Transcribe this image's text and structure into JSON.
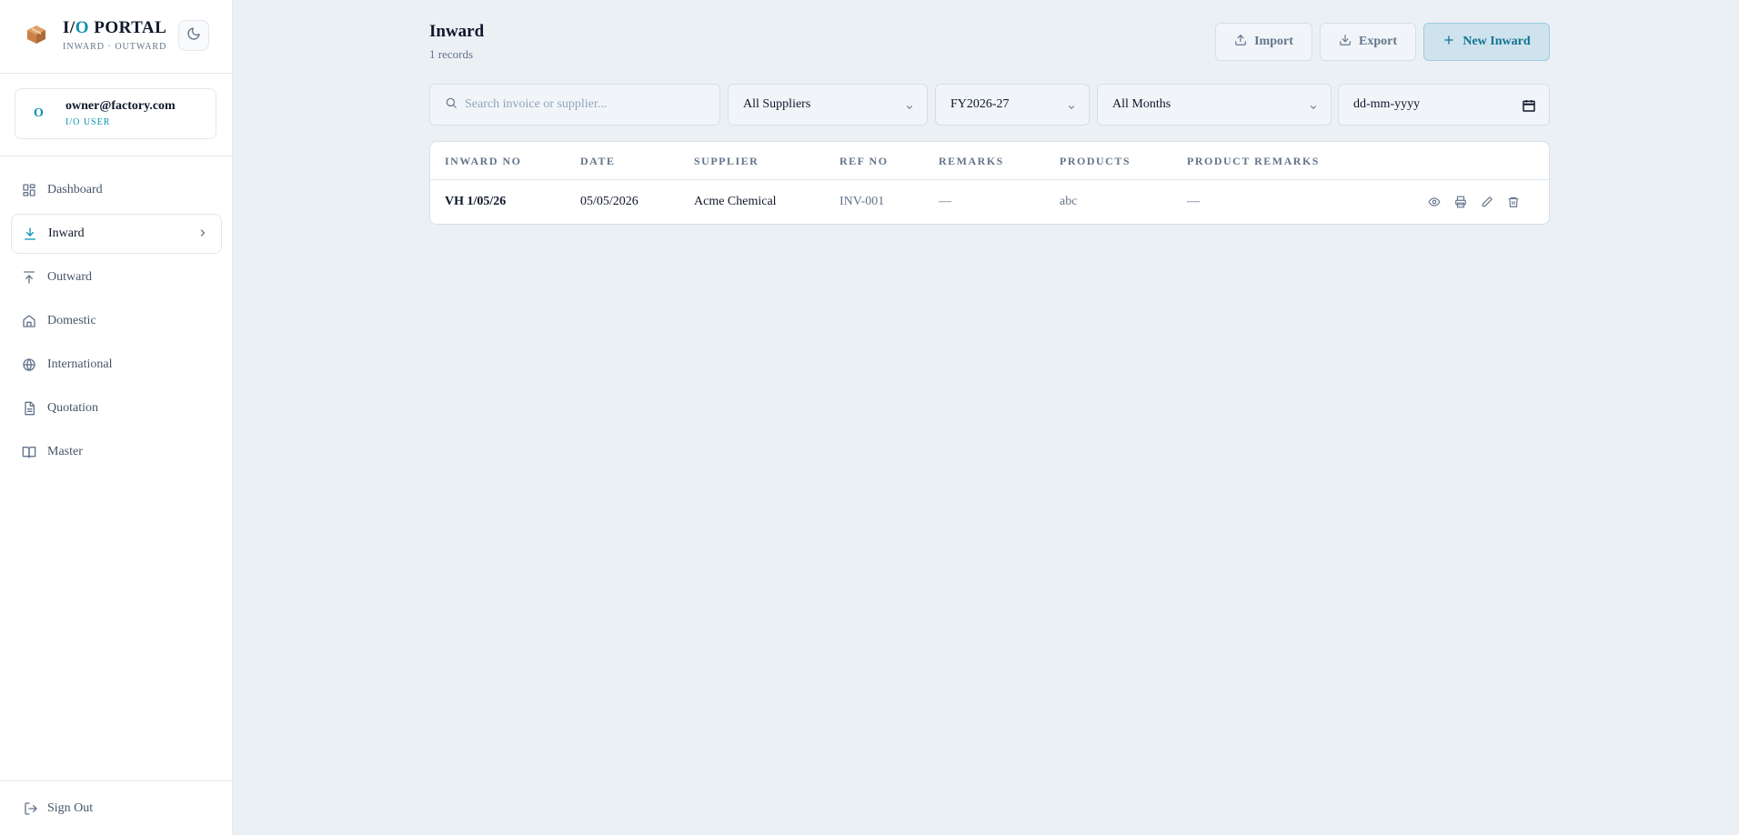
{
  "brand": {
    "title_a": "I/",
    "title_b": "O",
    "title_c": " PORTAL",
    "subtitle": "INWARD · OUTWARD",
    "logo_icon": "package-box-icon",
    "theme_icon": "moon-icon"
  },
  "user": {
    "avatar": "O",
    "email": "owner@factory.com",
    "role": "I/O USER"
  },
  "nav": {
    "items": [
      {
        "label": "Dashboard",
        "icon": "dashboard-icon"
      },
      {
        "label": "Inward",
        "icon": "download-icon",
        "active": true
      },
      {
        "label": "Outward",
        "icon": "upload-icon"
      },
      {
        "label": "Domestic",
        "icon": "home-icon"
      },
      {
        "label": "International",
        "icon": "globe-icon"
      },
      {
        "label": "Quotation",
        "icon": "document-icon"
      },
      {
        "label": "Master",
        "icon": "book-icon"
      }
    ],
    "signout": "Sign Out"
  },
  "header": {
    "title": "Inward",
    "count": "1 records",
    "import_label": "Import",
    "export_label": "Export",
    "new_label": "New Inward"
  },
  "filters": {
    "search_placeholder": "Search invoice or supplier...",
    "supplier": "All Suppliers",
    "fy": "FY2026-27",
    "month": "All Months",
    "date": "dd-mm-yyyy"
  },
  "table": {
    "columns": [
      "INWARD NO",
      "DATE",
      "SUPPLIER",
      "REF NO",
      "REMARKS",
      "PRODUCTS",
      "PRODUCT REMARKS"
    ],
    "rows": [
      {
        "inward_no": "VH 1/05/26",
        "date": "05/05/2026",
        "supplier": "Acme Chemical",
        "ref_no": "INV-001",
        "remarks": "—",
        "products": "abc",
        "product_remarks": "—"
      }
    ]
  },
  "colors": {
    "accent": "#0891b2",
    "background": "#ebf0f5",
    "sidebar": "#ffffff"
  }
}
